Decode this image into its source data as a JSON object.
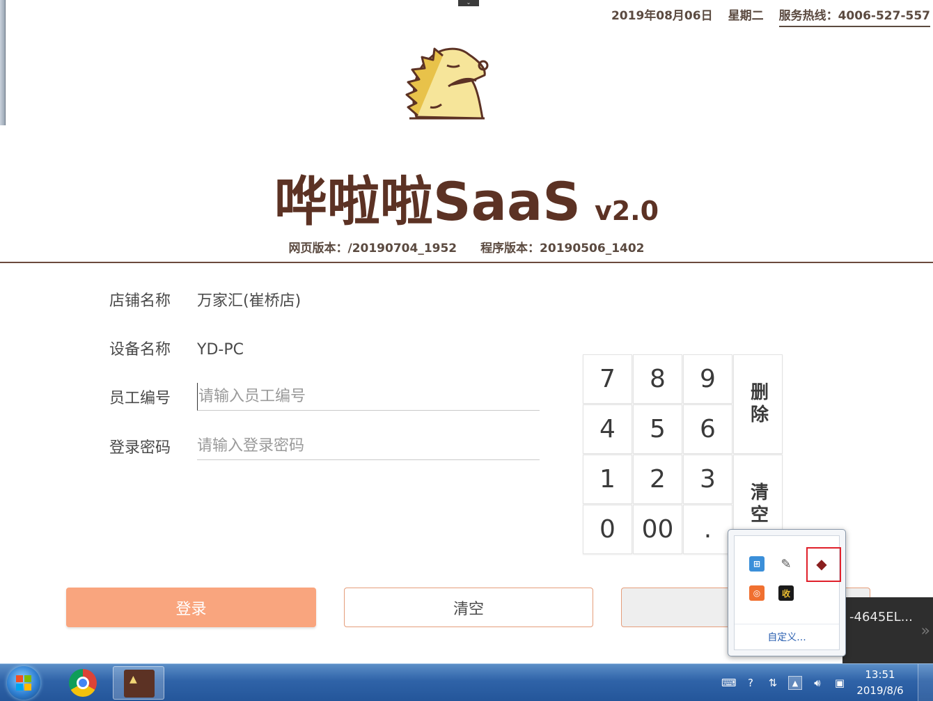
{
  "header": {
    "date": "2019年08月06日",
    "weekday": "星期二",
    "hotline": "服务热线：4006-527-557"
  },
  "brand": {
    "name": "哗啦啦SaaS",
    "version": "v2.0",
    "web_version": "网页版本：/20190704_1952",
    "program_version": "程序版本：20190506_1402"
  },
  "form": {
    "store_label": "店铺名称",
    "store_value": "万家汇(崔桥店)",
    "device_label": "设备名称",
    "device_value": "YD-PC",
    "employee_label": "员工编号",
    "employee_placeholder": "请输入员工编号",
    "password_label": "登录密码",
    "password_placeholder": "请输入登录密码"
  },
  "keypad": {
    "k7": "7",
    "k8": "8",
    "k9": "9",
    "k4": "4",
    "k5": "5",
    "k6": "6",
    "k1": "1",
    "k2": "2",
    "k3": "3",
    "k0": "0",
    "k00": "00",
    "kdot": ".",
    "delete": "删除",
    "clear": "清空"
  },
  "buttons": {
    "login": "登录",
    "clear": "清空",
    "third": ""
  },
  "tray_popup": {
    "customize": "自定义...",
    "icons": [
      "network-icon",
      "pen-icon",
      "saas-app-icon",
      "security-icon",
      "cashier-icon"
    ],
    "cashier_glyph": "收"
  },
  "side_panel": {
    "text": "-4645EL..."
  },
  "taskbar": {
    "time": "13:51",
    "date": "2019/8/6"
  },
  "colors": {
    "brand_brown": "#5c3224",
    "login_orange": "#f9a57e",
    "border_orange": "#e59d7a",
    "taskbar_blue": "#2f63a8"
  }
}
